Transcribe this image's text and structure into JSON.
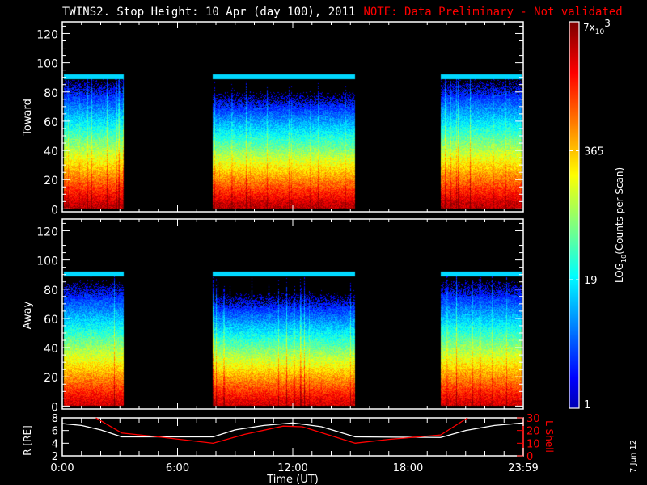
{
  "title": "TWINS2. Stop Height: 10 Apr (day 100), 2011",
  "note": "NOTE: Data Preliminary - Not validated",
  "datestamp": "7 Jun 12",
  "colors": {
    "note": "#ff0000",
    "r_line": "#ffffff",
    "lshell_line": "#ff0000"
  },
  "chart_data": [
    {
      "type": "heatmap",
      "name": "Toward",
      "ylabel": "Toward",
      "ylim": [
        0,
        128
      ],
      "yticks": [
        "0",
        "20",
        "40",
        "60",
        "80",
        "100",
        "120"
      ],
      "xlim_hours": [
        0,
        24
      ],
      "data_top": 92,
      "blocks_hours": [
        [
          0.1,
          3.2
        ],
        [
          7.85,
          15.25
        ],
        [
          19.7,
          23.9
        ]
      ]
    },
    {
      "type": "heatmap",
      "name": "Away",
      "ylabel": "Away",
      "ylim": [
        0,
        128
      ],
      "yticks": [
        "0",
        "20",
        "40",
        "60",
        "80",
        "100",
        "120"
      ],
      "xlim_hours": [
        0,
        24
      ],
      "data_top": 92,
      "blocks_hours": [
        [
          0.1,
          3.2
        ],
        [
          7.85,
          15.25
        ],
        [
          19.7,
          23.9
        ]
      ]
    },
    {
      "type": "line",
      "ylabel_left": "R [RE]",
      "ylabel_right": "L Shell",
      "ylim_left": [
        2,
        8
      ],
      "ylim_right": [
        0,
        30
      ],
      "yticks_left": [
        "2",
        "4",
        "6",
        "8"
      ],
      "yticks_right": [
        "0",
        "10",
        "20",
        "30"
      ],
      "xlabel": "Time (UT)",
      "xticks": [
        "0:00",
        "6:00",
        "12:00",
        "18:00",
        "23:59"
      ],
      "series": [
        {
          "name": "R",
          "axis": "left",
          "x": [
            0,
            1,
            2,
            3.1,
            7.85,
            9,
            10.5,
            12,
            13.5,
            15.25,
            19.7,
            21,
            22.5,
            24
          ],
          "y": [
            7.1,
            6.8,
            6.1,
            5.0,
            5.0,
            6.1,
            6.8,
            7.2,
            6.6,
            5.0,
            4.9,
            6.0,
            6.8,
            7.2
          ]
        },
        {
          "name": "L Shell",
          "axis": "right",
          "x": [
            1.75,
            3.1,
            5,
            7.85,
            9.5,
            11.5,
            12.5,
            15.25,
            17,
            19.7,
            21.1
          ],
          "y": [
            30,
            18,
            15,
            10,
            17,
            23.5,
            23,
            10,
            13,
            16.5,
            30
          ]
        }
      ]
    },
    {
      "type": "colorbar",
      "label": "LOG10(Counts per Scan)",
      "label_main": "LOG",
      "label_sub": "10",
      "label_rest": "(Counts per Scan)",
      "range": [
        1,
        7000
      ],
      "ticks": [
        {
          "value": 1,
          "label": "1"
        },
        {
          "value": 19,
          "label": "19"
        },
        {
          "value": 365,
          "label": "365"
        }
      ],
      "max_label": {
        "base": "7x",
        "sub": "10",
        "sup": "3"
      }
    }
  ]
}
